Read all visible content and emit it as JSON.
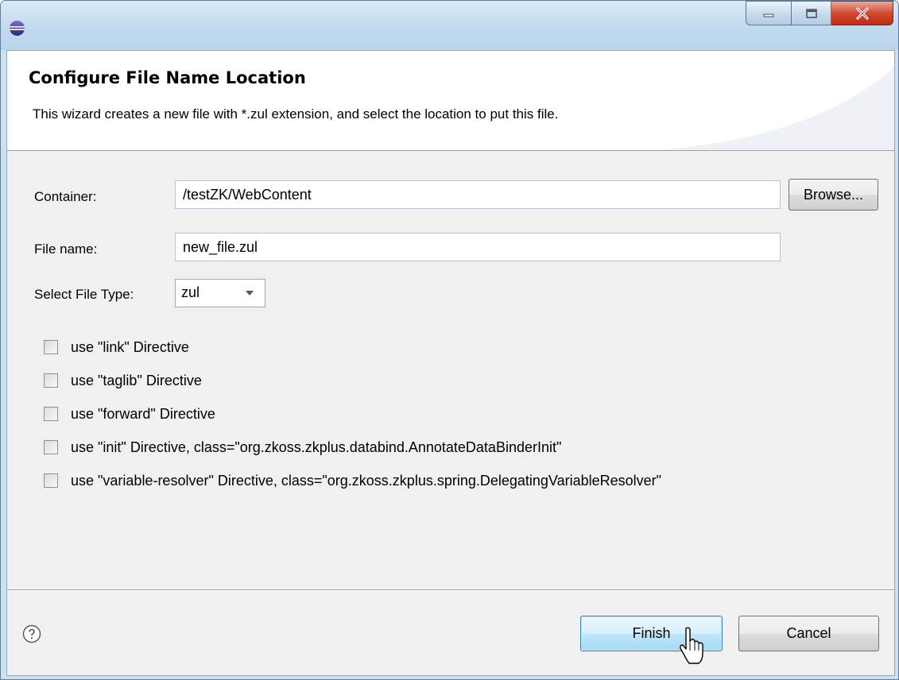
{
  "banner": {
    "title": "Configure File Name  Location",
    "description": "This wizard creates a new file with *.zul extension, and select the location to put this file."
  },
  "container": {
    "label": "Container:",
    "value": "/testZK/WebContent",
    "browse_label": "Browse..."
  },
  "file_name": {
    "label": "File name:",
    "value": "new_file.zul"
  },
  "file_type": {
    "label": "Select File Type:",
    "value": "zul"
  },
  "options": [
    {
      "label": "use \"link\" Directive",
      "checked": false
    },
    {
      "label": "use \"taglib\" Directive",
      "checked": false
    },
    {
      "label": "use \"forward\" Directive",
      "checked": false
    },
    {
      "label": "use \"init\" Directive, class=\"org.zkoss.zkplus.databind.AnnotateDataBinderInit\"",
      "checked": false
    },
    {
      "label": "use \"variable-resolver\" Directive, class=\"org.zkoss.zkplus.spring.DelegatingVariableResolver\"",
      "checked": false
    }
  ],
  "footer": {
    "finish_label": "Finish",
    "cancel_label": "Cancel"
  },
  "icons": {
    "app": "eclipse-icon",
    "help": "help-icon",
    "minimize": "minimize-icon",
    "maximize": "maximize-icon",
    "close": "close-icon",
    "dropdown": "chevron-down-icon",
    "cursor": "mouse-pointer-icon"
  },
  "colors": {
    "close_button": "#c9442b",
    "default_button": "#bee6fd",
    "dialog_bg": "#f0f0f0"
  }
}
